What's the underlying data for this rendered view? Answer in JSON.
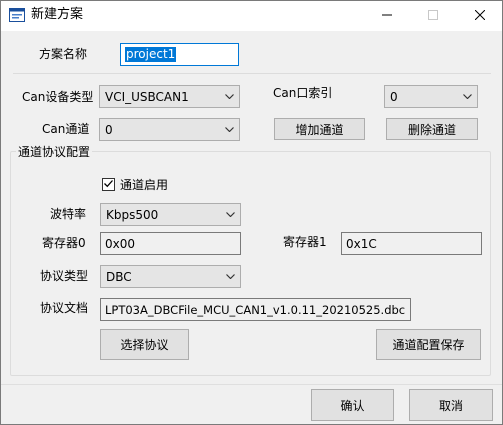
{
  "window": {
    "title": "新建方案",
    "app_icon": "window-form-icon",
    "controls": {
      "minimize": "minimize-icon",
      "maximize": "maximize-icon",
      "close": "close-icon"
    }
  },
  "scheme": {
    "label": "方案名称",
    "value": "project1"
  },
  "device": {
    "type_label": "Can设备类型",
    "type_value": "VCI_USBCAN1",
    "index_label": "Can口索引",
    "index_value": "0",
    "channel_label": "Can通道",
    "channel_value": "0",
    "add_channel_button": "增加通道",
    "delete_channel_button": "删除通道"
  },
  "protocol_group": {
    "title": "通道协议配置",
    "enable_label": "通道启用",
    "enable_checked": true,
    "baud_label": "波特率",
    "baud_value": "Kbps500",
    "reg0_label": "寄存器0",
    "reg0_value": "0x00",
    "reg1_label": "寄存器1",
    "reg1_value": "0x1C",
    "proto_type_label": "协议类型",
    "proto_type_value": "DBC",
    "proto_file_label": "协议文档",
    "proto_file_value": "LPT03A_DBCFile_MCU_CAN1_v1.0.11_20210525.dbc",
    "select_protocol_button": "选择协议",
    "save_channel_button": "通道配置保存"
  },
  "footer": {
    "ok_button": "确认",
    "cancel_button": "取消"
  }
}
